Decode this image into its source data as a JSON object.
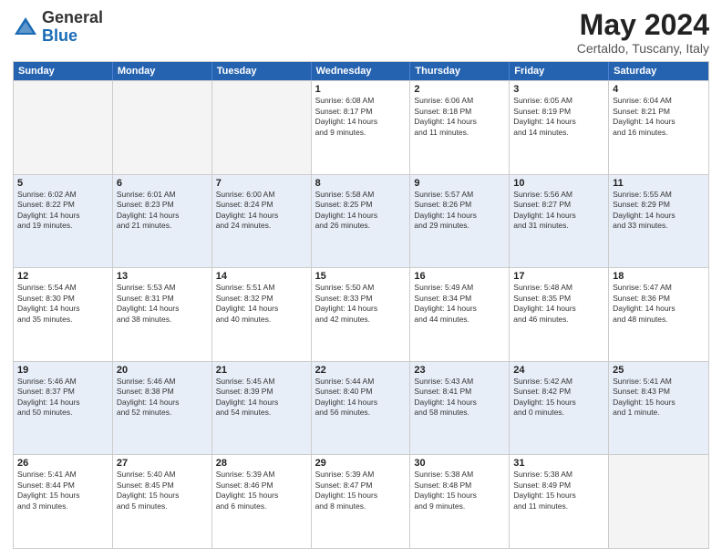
{
  "header": {
    "logo_general": "General",
    "logo_blue": "Blue",
    "title": "May 2024",
    "subtitle": "Certaldo, Tuscany, Italy"
  },
  "calendar": {
    "days": [
      "Sunday",
      "Monday",
      "Tuesday",
      "Wednesday",
      "Thursday",
      "Friday",
      "Saturday"
    ],
    "rows": [
      [
        {
          "day": "",
          "text": ""
        },
        {
          "day": "",
          "text": ""
        },
        {
          "day": "",
          "text": ""
        },
        {
          "day": "1",
          "text": "Sunrise: 6:08 AM\nSunset: 8:17 PM\nDaylight: 14 hours\nand 9 minutes."
        },
        {
          "day": "2",
          "text": "Sunrise: 6:06 AM\nSunset: 8:18 PM\nDaylight: 14 hours\nand 11 minutes."
        },
        {
          "day": "3",
          "text": "Sunrise: 6:05 AM\nSunset: 8:19 PM\nDaylight: 14 hours\nand 14 minutes."
        },
        {
          "day": "4",
          "text": "Sunrise: 6:04 AM\nSunset: 8:21 PM\nDaylight: 14 hours\nand 16 minutes."
        }
      ],
      [
        {
          "day": "5",
          "text": "Sunrise: 6:02 AM\nSunset: 8:22 PM\nDaylight: 14 hours\nand 19 minutes."
        },
        {
          "day": "6",
          "text": "Sunrise: 6:01 AM\nSunset: 8:23 PM\nDaylight: 14 hours\nand 21 minutes."
        },
        {
          "day": "7",
          "text": "Sunrise: 6:00 AM\nSunset: 8:24 PM\nDaylight: 14 hours\nand 24 minutes."
        },
        {
          "day": "8",
          "text": "Sunrise: 5:58 AM\nSunset: 8:25 PM\nDaylight: 14 hours\nand 26 minutes."
        },
        {
          "day": "9",
          "text": "Sunrise: 5:57 AM\nSunset: 8:26 PM\nDaylight: 14 hours\nand 29 minutes."
        },
        {
          "day": "10",
          "text": "Sunrise: 5:56 AM\nSunset: 8:27 PM\nDaylight: 14 hours\nand 31 minutes."
        },
        {
          "day": "11",
          "text": "Sunrise: 5:55 AM\nSunset: 8:29 PM\nDaylight: 14 hours\nand 33 minutes."
        }
      ],
      [
        {
          "day": "12",
          "text": "Sunrise: 5:54 AM\nSunset: 8:30 PM\nDaylight: 14 hours\nand 35 minutes."
        },
        {
          "day": "13",
          "text": "Sunrise: 5:53 AM\nSunset: 8:31 PM\nDaylight: 14 hours\nand 38 minutes."
        },
        {
          "day": "14",
          "text": "Sunrise: 5:51 AM\nSunset: 8:32 PM\nDaylight: 14 hours\nand 40 minutes."
        },
        {
          "day": "15",
          "text": "Sunrise: 5:50 AM\nSunset: 8:33 PM\nDaylight: 14 hours\nand 42 minutes."
        },
        {
          "day": "16",
          "text": "Sunrise: 5:49 AM\nSunset: 8:34 PM\nDaylight: 14 hours\nand 44 minutes."
        },
        {
          "day": "17",
          "text": "Sunrise: 5:48 AM\nSunset: 8:35 PM\nDaylight: 14 hours\nand 46 minutes."
        },
        {
          "day": "18",
          "text": "Sunrise: 5:47 AM\nSunset: 8:36 PM\nDaylight: 14 hours\nand 48 minutes."
        }
      ],
      [
        {
          "day": "19",
          "text": "Sunrise: 5:46 AM\nSunset: 8:37 PM\nDaylight: 14 hours\nand 50 minutes."
        },
        {
          "day": "20",
          "text": "Sunrise: 5:46 AM\nSunset: 8:38 PM\nDaylight: 14 hours\nand 52 minutes."
        },
        {
          "day": "21",
          "text": "Sunrise: 5:45 AM\nSunset: 8:39 PM\nDaylight: 14 hours\nand 54 minutes."
        },
        {
          "day": "22",
          "text": "Sunrise: 5:44 AM\nSunset: 8:40 PM\nDaylight: 14 hours\nand 56 minutes."
        },
        {
          "day": "23",
          "text": "Sunrise: 5:43 AM\nSunset: 8:41 PM\nDaylight: 14 hours\nand 58 minutes."
        },
        {
          "day": "24",
          "text": "Sunrise: 5:42 AM\nSunset: 8:42 PM\nDaylight: 15 hours\nand 0 minutes."
        },
        {
          "day": "25",
          "text": "Sunrise: 5:41 AM\nSunset: 8:43 PM\nDaylight: 15 hours\nand 1 minute."
        }
      ],
      [
        {
          "day": "26",
          "text": "Sunrise: 5:41 AM\nSunset: 8:44 PM\nDaylight: 15 hours\nand 3 minutes."
        },
        {
          "day": "27",
          "text": "Sunrise: 5:40 AM\nSunset: 8:45 PM\nDaylight: 15 hours\nand 5 minutes."
        },
        {
          "day": "28",
          "text": "Sunrise: 5:39 AM\nSunset: 8:46 PM\nDaylight: 15 hours\nand 6 minutes."
        },
        {
          "day": "29",
          "text": "Sunrise: 5:39 AM\nSunset: 8:47 PM\nDaylight: 15 hours\nand 8 minutes."
        },
        {
          "day": "30",
          "text": "Sunrise: 5:38 AM\nSunset: 8:48 PM\nDaylight: 15 hours\nand 9 minutes."
        },
        {
          "day": "31",
          "text": "Sunrise: 5:38 AM\nSunset: 8:49 PM\nDaylight: 15 hours\nand 11 minutes."
        },
        {
          "day": "",
          "text": ""
        }
      ]
    ]
  }
}
